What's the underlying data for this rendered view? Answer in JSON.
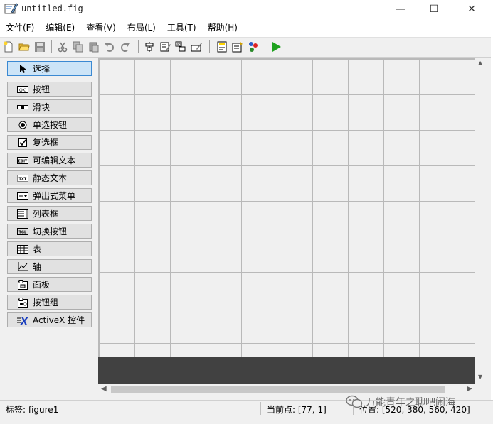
{
  "window": {
    "title": "untitled.fig",
    "minimize": "—",
    "maximize": "☐",
    "close": "✕"
  },
  "menu": [
    "文件(F)",
    "编辑(E)",
    "查看(V)",
    "布局(L)",
    "工具(T)",
    "帮助(H)"
  ],
  "toolbar": {
    "icons": [
      "new-file-icon",
      "open-folder-icon",
      "save-icon",
      "cut-icon",
      "copy-icon",
      "paste-icon",
      "undo-icon",
      "redo-icon",
      "align-icon",
      "menu-editor-icon",
      "tab-order-icon",
      "toolbar-editor-icon",
      "editor-icon",
      "property-inspector-icon",
      "object-browser-icon",
      "run-icon"
    ]
  },
  "palette": {
    "items": [
      {
        "label": "选择",
        "icon": "arrow-cursor-icon",
        "glyph": "➤"
      },
      {
        "label": "按钮",
        "icon": "pushbutton-icon",
        "glyph": "OK"
      },
      {
        "label": "滑块",
        "icon": "slider-icon",
        "glyph": ""
      },
      {
        "label": "单选按钮",
        "icon": "radio-button-icon",
        "glyph": "◉"
      },
      {
        "label": "复选框",
        "icon": "checkbox-icon",
        "glyph": "☑"
      },
      {
        "label": "可编辑文本",
        "icon": "edit-text-icon",
        "glyph": "EDIT"
      },
      {
        "label": "静态文本",
        "icon": "static-text-icon",
        "glyph": "TXT"
      },
      {
        "label": "弹出式菜单",
        "icon": "popup-menu-icon",
        "glyph": ""
      },
      {
        "label": "列表框",
        "icon": "listbox-icon",
        "glyph": ""
      },
      {
        "label": "切换按钮",
        "icon": "toggle-button-icon",
        "glyph": "TGL"
      },
      {
        "label": "表",
        "icon": "table-icon",
        "glyph": ""
      },
      {
        "label": "轴",
        "icon": "axes-icon",
        "glyph": ""
      },
      {
        "label": "面板",
        "icon": "panel-icon",
        "glyph": ""
      },
      {
        "label": "按钮组",
        "icon": "button-group-icon",
        "glyph": ""
      },
      {
        "label": "ActiveX 控件",
        "icon": "activex-icon",
        "glyph": "X"
      }
    ]
  },
  "status": {
    "tag": "标签: figure1",
    "current_point": "当前点:   [77, 1]",
    "position": "位置: [520, 380, 560, 420]"
  },
  "watermark": {
    "text": "万能青年之聊吧闹海"
  },
  "colors": {
    "selected_bg": "#cce4f7",
    "selected_border": "#3b89d2",
    "run_green": "#1ea21e",
    "dark_area": "#414141"
  }
}
